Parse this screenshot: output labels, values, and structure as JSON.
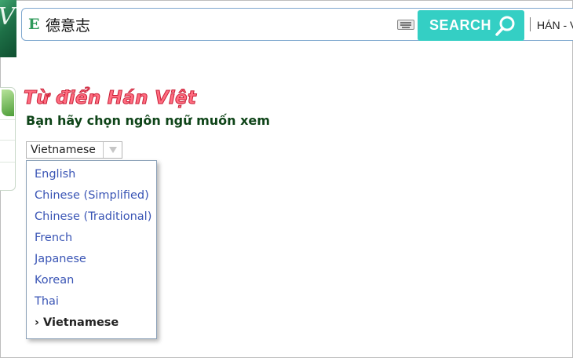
{
  "header": {
    "logo_letter": "V",
    "lang_badge": "E",
    "search_value": "德意志",
    "search_button_label": "SEARCH",
    "mode_label": "HÁN - VIỆT"
  },
  "main": {
    "title": "Từ điển Hán Việt",
    "subtitle": "Bạn hãy chọn ngôn ngữ muốn xem",
    "select": {
      "selected": "Vietnamese",
      "options": [
        "English",
        "Chinese (Simplified)",
        "Chinese (Traditional)",
        "French",
        "Japanese",
        "Korean",
        "Thai",
        "› Vietnamese"
      ]
    }
  },
  "colors": {
    "search_button": "#34cfc4",
    "title": "#ff6d80",
    "subtitle": "#0e4418",
    "option_text": "#3a55b5",
    "logo": "#1e7047"
  },
  "icons": [
    "search-icon",
    "keyboard-icon",
    "dropdown-arrow-icon",
    "leaf-icon"
  ]
}
